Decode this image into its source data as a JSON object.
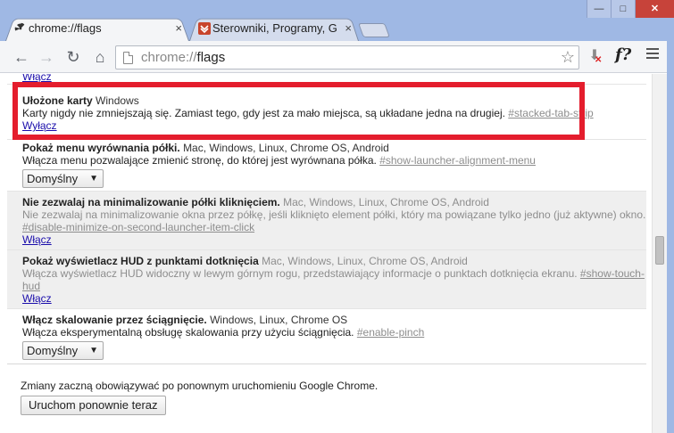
{
  "tabs": [
    {
      "title": "chrome://flags",
      "close": "×"
    },
    {
      "title": "Sterowniki, Programy, Gry",
      "close": "×"
    }
  ],
  "window_buttons": {
    "minimize": "—",
    "maximize": "□",
    "close": "✕"
  },
  "toolbar": {
    "back": "←",
    "forward": "→",
    "reload": "↻",
    "home": "⌂",
    "url_scheme": "chrome://",
    "url_path": "flags",
    "star": "☆",
    "ext_f": "f?"
  },
  "flags": [
    {
      "action": "Włącz"
    },
    {
      "name": "Ułożone karty",
      "platforms": "Windows",
      "desc": "Karty nigdy nie zmniejszają się. Zamiast tego, gdy jest za mało miejsca, są układane jedna na drugiej.",
      "anchor": "#stacked-tab-strip",
      "action": "Wyłącz"
    },
    {
      "name": "Pokaż menu wyrównania półki.",
      "platforms": "Mac, Windows, Linux, Chrome OS, Android",
      "desc": "Włącza menu pozwalające zmienić stronę, do której jest wyrównana półka.",
      "anchor": "#show-launcher-alignment-menu",
      "select": "Domyślny"
    },
    {
      "name": "Nie zezwalaj na minimalizowanie półki kliknięciem.",
      "platforms": "Mac, Windows, Linux, Chrome OS, Android",
      "desc": "Nie zezwalaj na minimalizowanie okna przez półkę, jeśli kliknięto element półki, który ma powiązane tylko jedno (już aktywne) okno.",
      "anchor": "#disable-minimize-on-second-launcher-item-click",
      "action": "Włącz"
    },
    {
      "name": "Pokaż wyświetlacz HUD z punktami dotknięcia",
      "platforms": "Mac, Windows, Linux, Chrome OS, Android",
      "desc": "Włącza wyświetlacz HUD widoczny w lewym górnym rogu, przedstawiający informacje o punktach dotknięcia ekranu.",
      "anchor_part1": "#show-touch-",
      "anchor_part2": "hud",
      "action": "Włącz"
    },
    {
      "name": "Włącz skalowanie przez ściągnięcie.",
      "platforms": "Windows, Linux, Chrome OS",
      "desc": "Włącza eksperymentalną obsługę skalowania przy użyciu ściągnięcia.",
      "anchor": "#enable-pinch",
      "select": "Domyślny"
    }
  ],
  "restart": {
    "message": "Zmiany zaczną obowiązywać po ponownym uruchomieniu Google Chrome.",
    "button": "Uruchom ponownie teraz"
  },
  "colors": {
    "highlight": "#e41d2d",
    "link": "#1a0dab",
    "frame": "#9fb8e4"
  }
}
